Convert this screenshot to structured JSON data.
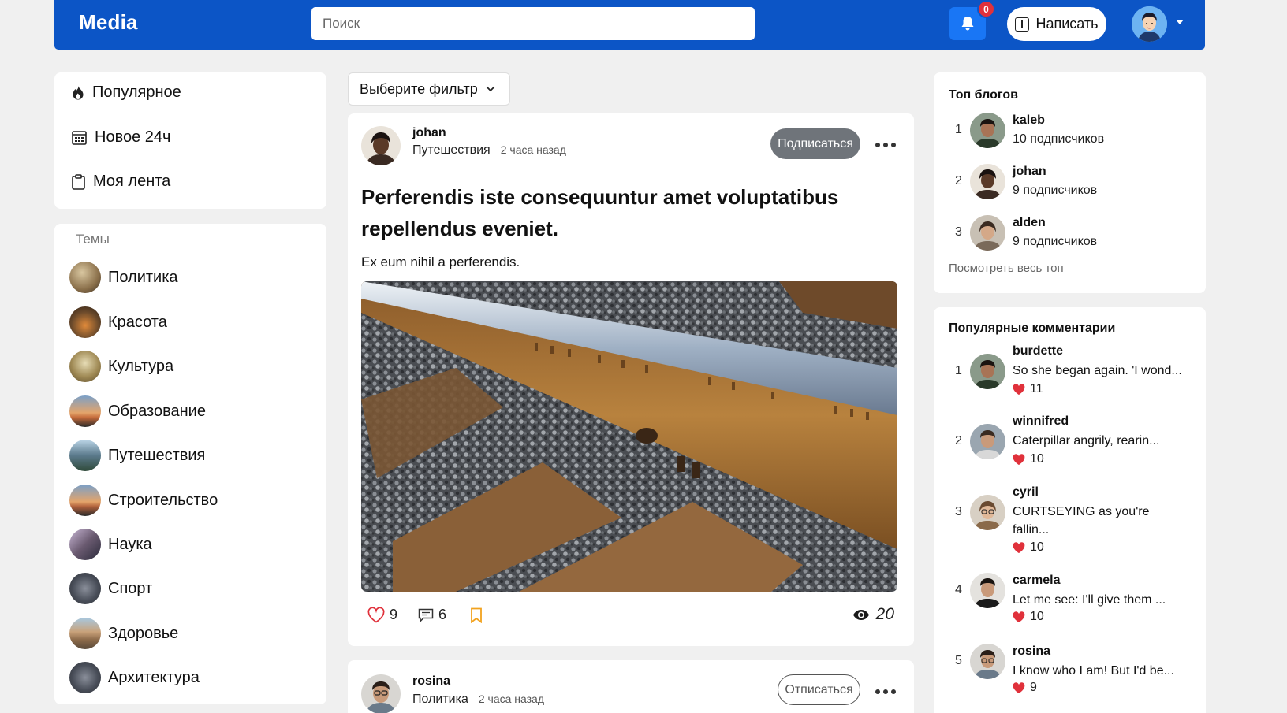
{
  "header": {
    "logo": "Media",
    "search_placeholder": "Поиск",
    "notifications_count": "0",
    "write_label": "Написать"
  },
  "nav": [
    {
      "label": "Популярное",
      "icon": "fire-icon"
    },
    {
      "label": "Новое 24ч",
      "icon": "calendar-icon"
    },
    {
      "label": "Моя лента",
      "icon": "clipboard-icon"
    }
  ],
  "topics": {
    "title": "Темы",
    "items": [
      {
        "label": "Политика",
        "color": "#8a6f4a"
      },
      {
        "label": "Красота",
        "color": "#6b4a2b"
      },
      {
        "label": "Культура",
        "color": "#a08a55"
      },
      {
        "label": "Образование",
        "color": "#c46a3a"
      },
      {
        "label": "Путешествия",
        "color": "#5b7a8c"
      },
      {
        "label": "Строительство",
        "color": "#b0603b"
      },
      {
        "label": "Наука",
        "color": "#6a5a70"
      },
      {
        "label": "Спорт",
        "color": "#4a4f5a"
      },
      {
        "label": "Здоровье",
        "color": "#8c6a4a"
      },
      {
        "label": "Архитектура",
        "color": "#4a4f5a"
      }
    ]
  },
  "feed": {
    "filter_label": "Выберите фильтр",
    "posts": [
      {
        "author": "johan",
        "topic": "Путешествия",
        "time": "2 часа назад",
        "follow_label": "Подписаться",
        "title": "Perferendis iste consequuntur amet voluptatibus repellendus eveniet.",
        "text": "Ex eum nihil a perferendis.",
        "likes": "9",
        "comments": "6",
        "views": "20"
      },
      {
        "author": "rosina",
        "topic": "Политика",
        "time": "2 часа назад",
        "follow_label": "Отписаться"
      }
    ]
  },
  "top_blogs": {
    "title": "Топ блогов",
    "items": [
      {
        "rank": "1",
        "name": "kaleb",
        "subs": "10 подписчиков"
      },
      {
        "rank": "2",
        "name": "johan",
        "subs": "9 подписчиков"
      },
      {
        "rank": "3",
        "name": "alden",
        "subs": "9 подписчиков"
      }
    ],
    "link": "Посмотреть весь топ"
  },
  "popular_comments": {
    "title": "Популярные комментарии",
    "items": [
      {
        "rank": "1",
        "name": "burdette",
        "text": "So she began again. 'I wond...",
        "likes": "11"
      },
      {
        "rank": "2",
        "name": "winnifred",
        "text": "Caterpillar angrily, rearin...",
        "likes": "10"
      },
      {
        "rank": "3",
        "name": "cyril",
        "text": "CURTSEYING as you're fallin...",
        "likes": "10"
      },
      {
        "rank": "4",
        "name": "carmela",
        "text": "Let me see: I'll give them ...",
        "likes": "10"
      },
      {
        "rank": "5",
        "name": "rosina",
        "text": "I know who I am! But I'd be...",
        "likes": "9"
      }
    ]
  },
  "colors": {
    "header": "#0c55c6",
    "bell_button": "#1976f5",
    "badge": "#e0313b",
    "like_heart": "#e0313b",
    "bookmark": "#f2a21e"
  }
}
